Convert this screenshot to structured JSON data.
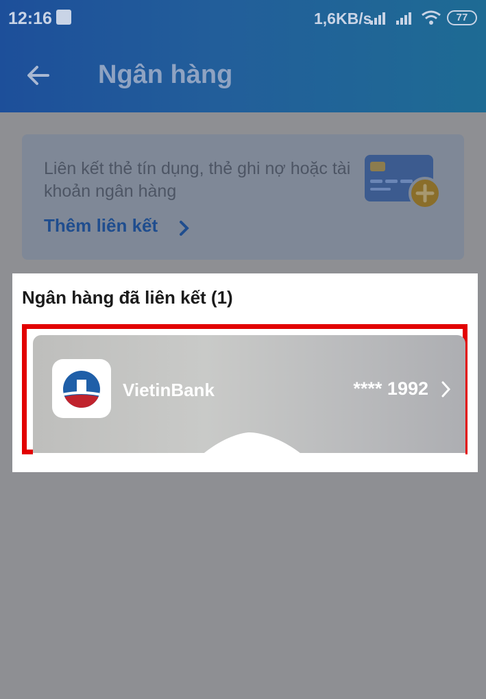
{
  "status_bar": {
    "time": "12:16",
    "network_speed": "1,6KB/s",
    "battery": "77",
    "icons": [
      "upload-icon",
      "signal-icon",
      "signal-icon",
      "wifi-icon",
      "battery-icon"
    ]
  },
  "header": {
    "title": "Ngân hàng",
    "back_icon": "arrow-left-icon"
  },
  "promo": {
    "text": "Liên kết thẻ tín dụng, thẻ ghi nợ hoặc tài khoản ngân hàng",
    "link_label": "Thêm liên kết",
    "illustration_icon": "credit-card-add-icon"
  },
  "linked_banks": {
    "title": "Ngân hàng đã liên kết (1)",
    "items": [
      {
        "name": "VietinBank",
        "account": "**** 1992"
      }
    ]
  },
  "colors": {
    "header": "#1d4f9a",
    "overlay_bg": "#8e8f93",
    "promo_link": "#1f4d8e",
    "highlight": "#e20000",
    "logo_blue": "#1f5fa8",
    "logo_red": "#c0232d"
  }
}
